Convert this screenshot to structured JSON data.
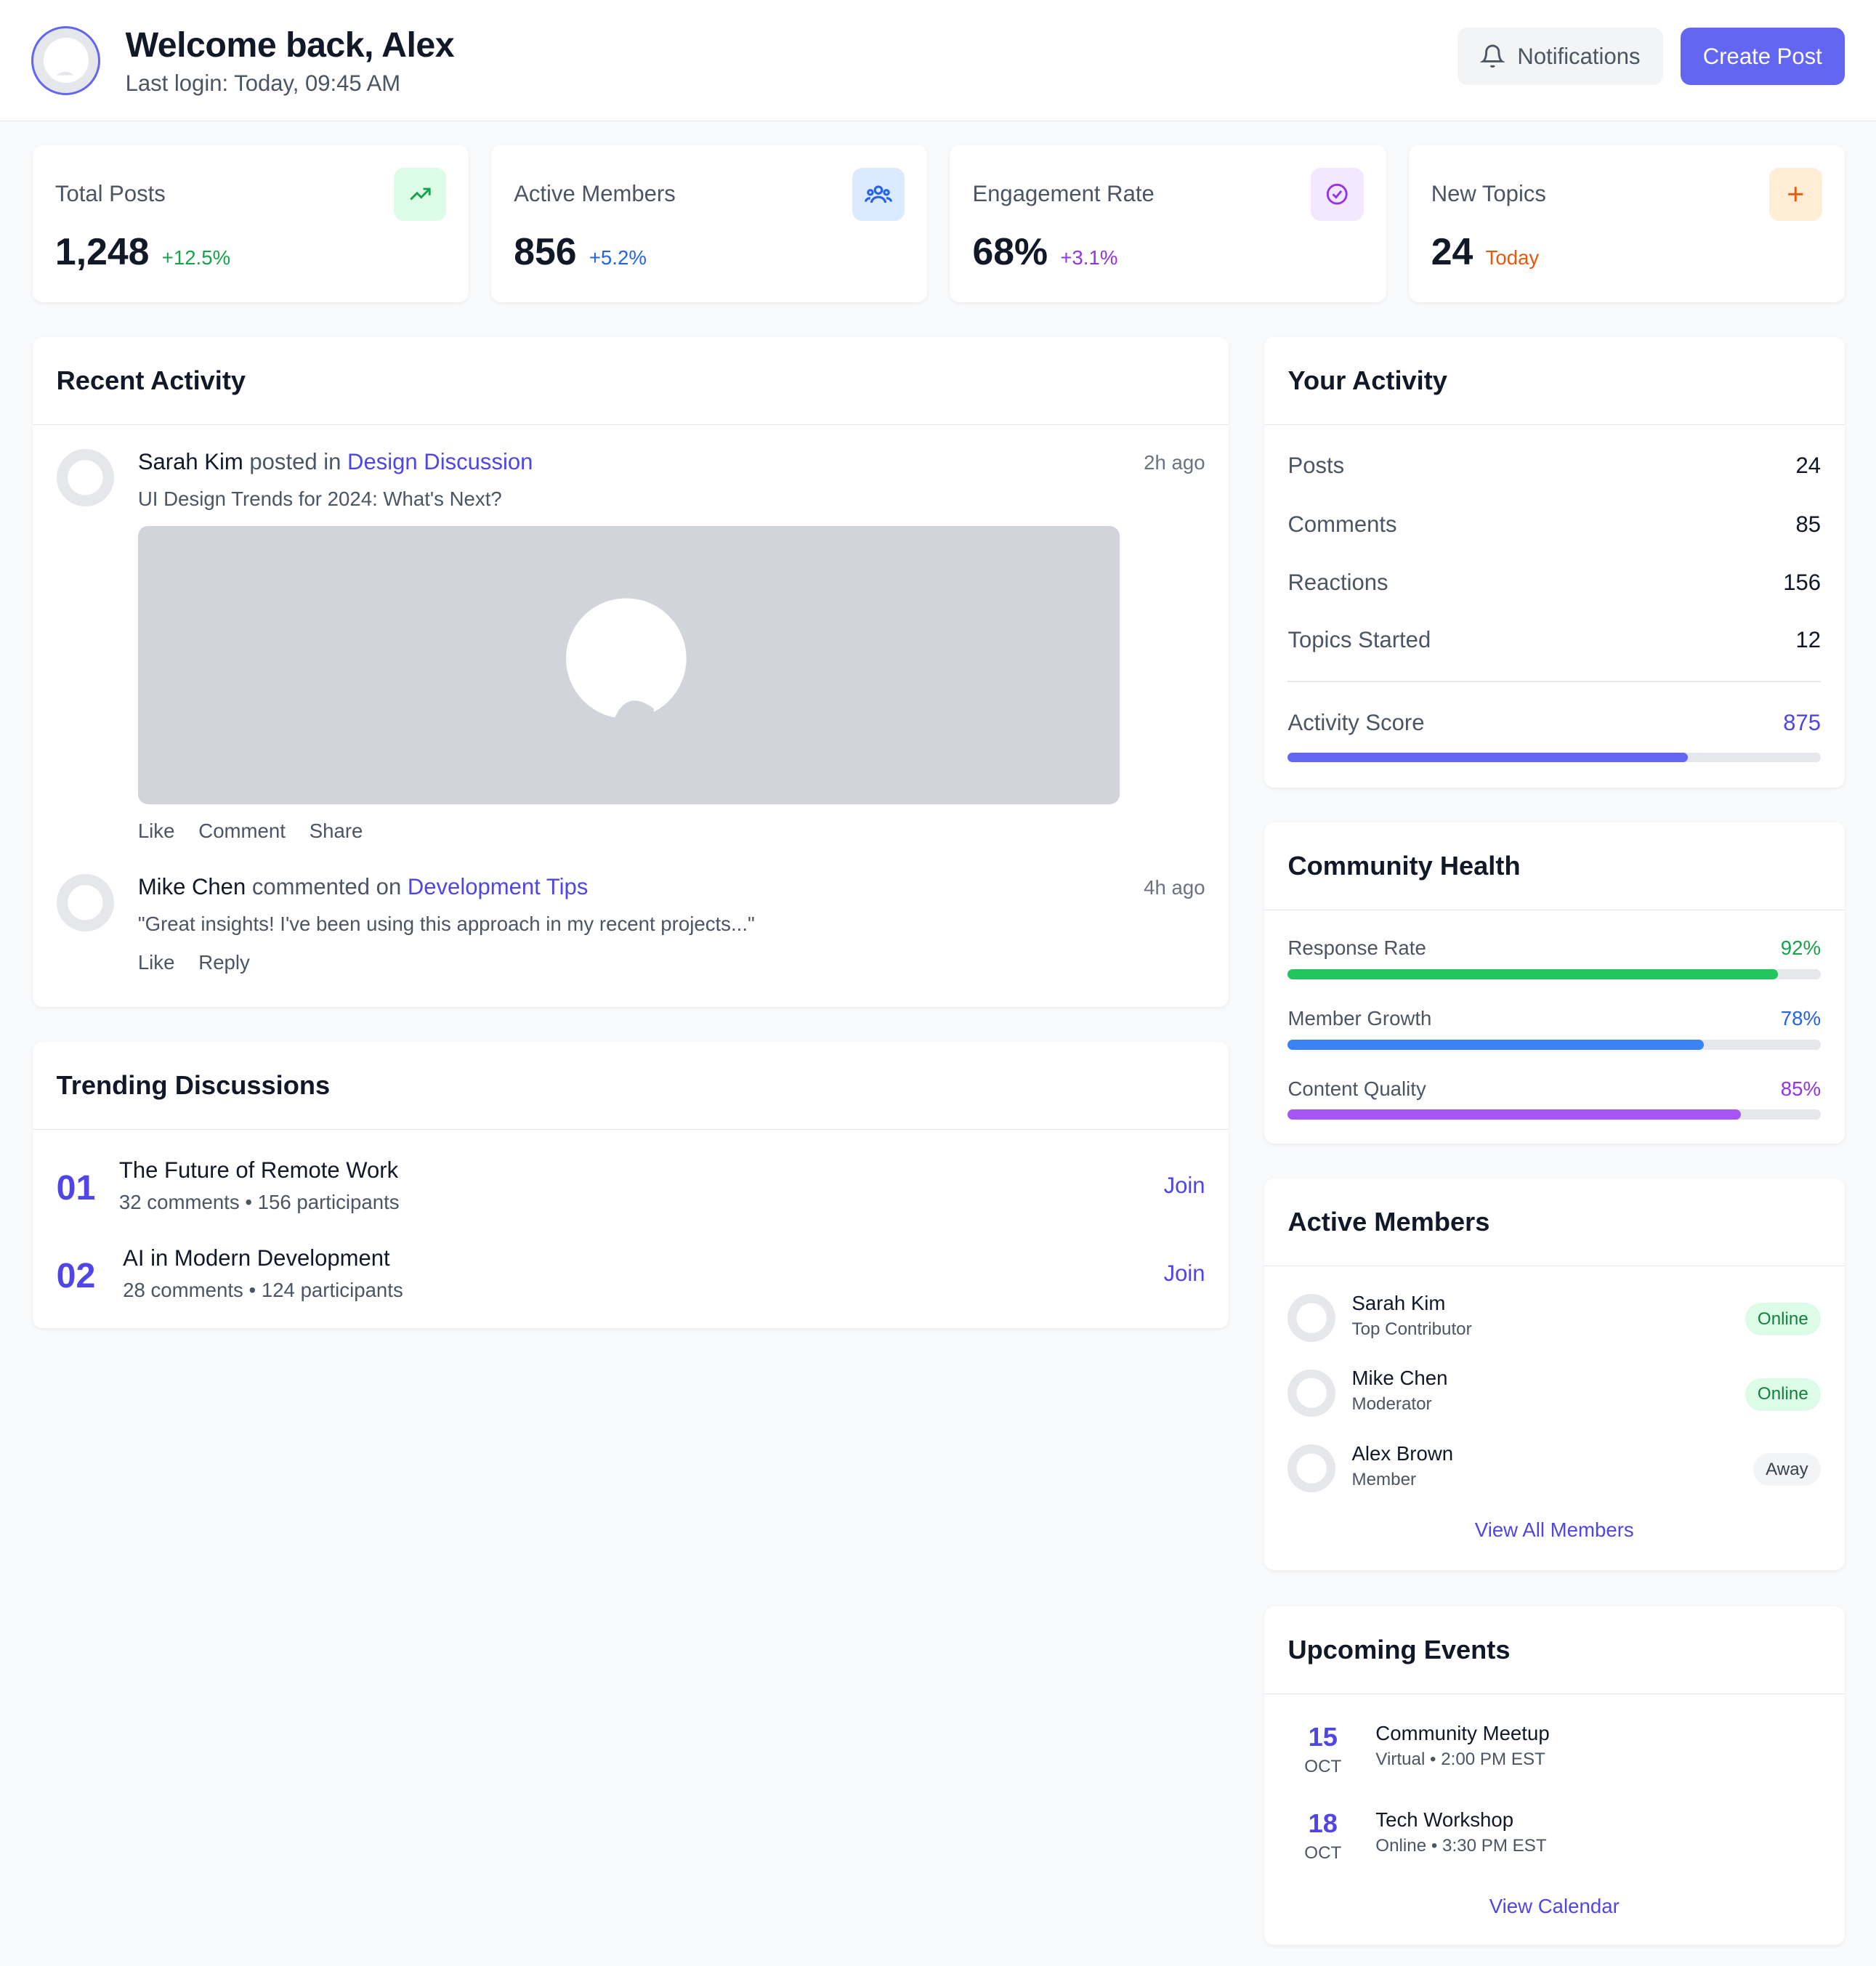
{
  "header": {
    "title": "Welcome back, Alex",
    "subtitle": "Last login: Today, 09:45 AM",
    "notifications_label": "Notifications",
    "create_label": "Create Post"
  },
  "stats": [
    {
      "label": "Total Posts",
      "value": "1,248",
      "delta": "+12.5%",
      "color": "#16a34a",
      "icon_bg": "#dcfce7",
      "icon": "trending-up-icon"
    },
    {
      "label": "Active Members",
      "value": "856",
      "delta": "+5.2%",
      "color": "#2563eb",
      "icon_bg": "#dbeafe",
      "icon": "users-icon"
    },
    {
      "label": "Engagement Rate",
      "value": "68%",
      "delta": "+3.1%",
      "color": "#9333ea",
      "icon_bg": "#f3e8ff",
      "icon": "check-circle-icon"
    },
    {
      "label": "New Topics",
      "value": "24",
      "delta": "Today",
      "color": "#ea580c",
      "icon_bg": "#ffedd5",
      "icon": "plus-icon"
    }
  ],
  "recent": {
    "title": "Recent Activity",
    "items": [
      {
        "user": "Sarah Kim",
        "verb": " posted in ",
        "target": "Design Discussion",
        "time": "2h ago",
        "text": "UI Design Trends for 2024: What's Next?",
        "actions": [
          "Like",
          "Comment",
          "Share"
        ]
      },
      {
        "user": "Mike Chen",
        "verb": " commented on ",
        "target": "Development Tips",
        "time": "4h ago",
        "text": "\"Great insights! I've been using this approach in my recent projects...\"",
        "actions": [
          "Like",
          "Reply"
        ]
      }
    ]
  },
  "trending": {
    "title": "Trending Discussions",
    "items": [
      {
        "num": "01",
        "title": "The Future of Remote Work",
        "meta": "32 comments • 156 participants",
        "action": "Join"
      },
      {
        "num": "02",
        "title": "AI in Modern Development",
        "meta": "28 comments • 124 participants",
        "action": "Join"
      }
    ]
  },
  "your_activity": {
    "title": "Your Activity",
    "rows": [
      {
        "label": "Posts",
        "value": "24"
      },
      {
        "label": "Comments",
        "value": "85"
      },
      {
        "label": "Reactions",
        "value": "156"
      },
      {
        "label": "Topics Started",
        "value": "12"
      }
    ],
    "score_label": "Activity Score",
    "score_value": "875",
    "score_fraction": 0.75
  },
  "health": {
    "title": "Community Health",
    "rows": [
      {
        "label": "Response Rate",
        "value": "92%",
        "color": "#22c55e",
        "percent": 92
      },
      {
        "label": "Member Growth",
        "value": "78%",
        "color": "#3b82f6",
        "percent": 78
      },
      {
        "label": "Content Quality",
        "value": "85%",
        "color": "#a855f7",
        "percent": 85
      }
    ]
  },
  "members": {
    "title": "Active Members",
    "items": [
      {
        "name": "Sarah Kim",
        "role": "Top Contributor",
        "status": "Online"
      },
      {
        "name": "Mike Chen",
        "role": "Moderator",
        "status": "Online"
      },
      {
        "name": "Alex Brown",
        "role": "Member",
        "status": "Away"
      }
    ],
    "link": "View All Members"
  },
  "events": {
    "title": "Upcoming Events",
    "items": [
      {
        "day": "15",
        "month": "OCT",
        "title": "Community Meetup",
        "meta": "Virtual • 2:00 PM EST"
      },
      {
        "day": "18",
        "month": "OCT",
        "title": "Tech Workshop",
        "meta": "Online • 3:30 PM EST"
      }
    ],
    "link": "View Calendar"
  }
}
